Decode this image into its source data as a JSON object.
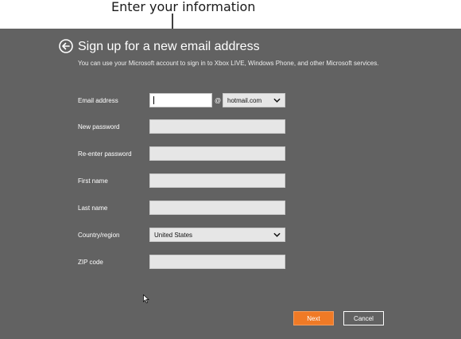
{
  "callout": {
    "text": "Enter your information"
  },
  "page": {
    "title": "Sign up for a new email address",
    "subtitle": "You can use your Microsoft account to sign in to Xbox LIVE, Windows Phone, and other Microsoft services."
  },
  "form": {
    "email_label": "Email address",
    "email_value": "",
    "at_symbol": "@",
    "domain_selected": "hotmail.com",
    "new_password_label": "New password",
    "reenter_password_label": "Re-enter password",
    "first_name_label": "First name",
    "last_name_label": "Last name",
    "country_label": "Country/region",
    "country_selected": "United States",
    "zip_label": "ZIP code"
  },
  "buttons": {
    "next": "Next",
    "cancel": "Cancel"
  },
  "colors": {
    "panel_background": "#626262",
    "accent_orange": "#f07a26",
    "field_background": "#e6e6e6"
  },
  "icons": {
    "back": "back-arrow-circle-icon",
    "dropdown": "chevron-down-icon",
    "pointer": "mouse-pointer-icon"
  }
}
